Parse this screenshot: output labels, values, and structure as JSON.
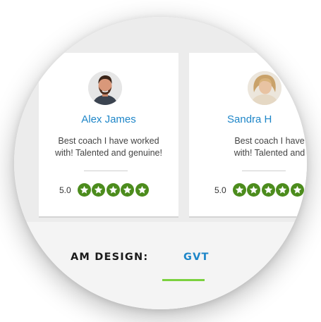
{
  "testimonials": [
    {
      "name": "Alex James",
      "quote_line1": "Best coach I have worked",
      "quote_line2": "with! Talented and genuine!",
      "score": "5.0",
      "stars": 5
    },
    {
      "name": "Sandra H",
      "quote_line1": "Best coach I have",
      "quote_line2": "with! Talented and",
      "score": "5.0",
      "stars": 5
    }
  ],
  "footer": {
    "label": "AM DESIGN:",
    "value": "GVT"
  },
  "colors": {
    "name": "#1e86c8",
    "star_badge": "#4c8c1d",
    "accent": "#7bd13e",
    "footer_value": "#1e86c8"
  }
}
